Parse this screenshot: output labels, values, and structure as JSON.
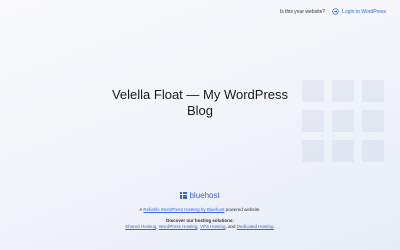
{
  "topbar": {
    "question": "Is this your website?",
    "login_label": "Login to WordPress"
  },
  "site": {
    "title": "Velella Float — My WordPress Blog"
  },
  "footer": {
    "brand_name": "bluehost",
    "powered_prefix": "A",
    "powered_link": "Reliable WordPress Hosting by Bluehost",
    "powered_suffix": "powered website.",
    "discover": "Discover our hosting solutions:",
    "links": {
      "shared": "Shared Hosting",
      "wordpress": "WordPress Hosting",
      "vps": "VPS Hosting",
      "dedicated": "Dedicated Hosting"
    },
    "and_text": "and",
    "sep": ",",
    "end": "."
  },
  "colors": {
    "link": "#3a6bd1",
    "brand": "#3b66c4"
  },
  "icons": {
    "login": "login-arrow-icon",
    "brand": "bluehost-grid-icon"
  }
}
